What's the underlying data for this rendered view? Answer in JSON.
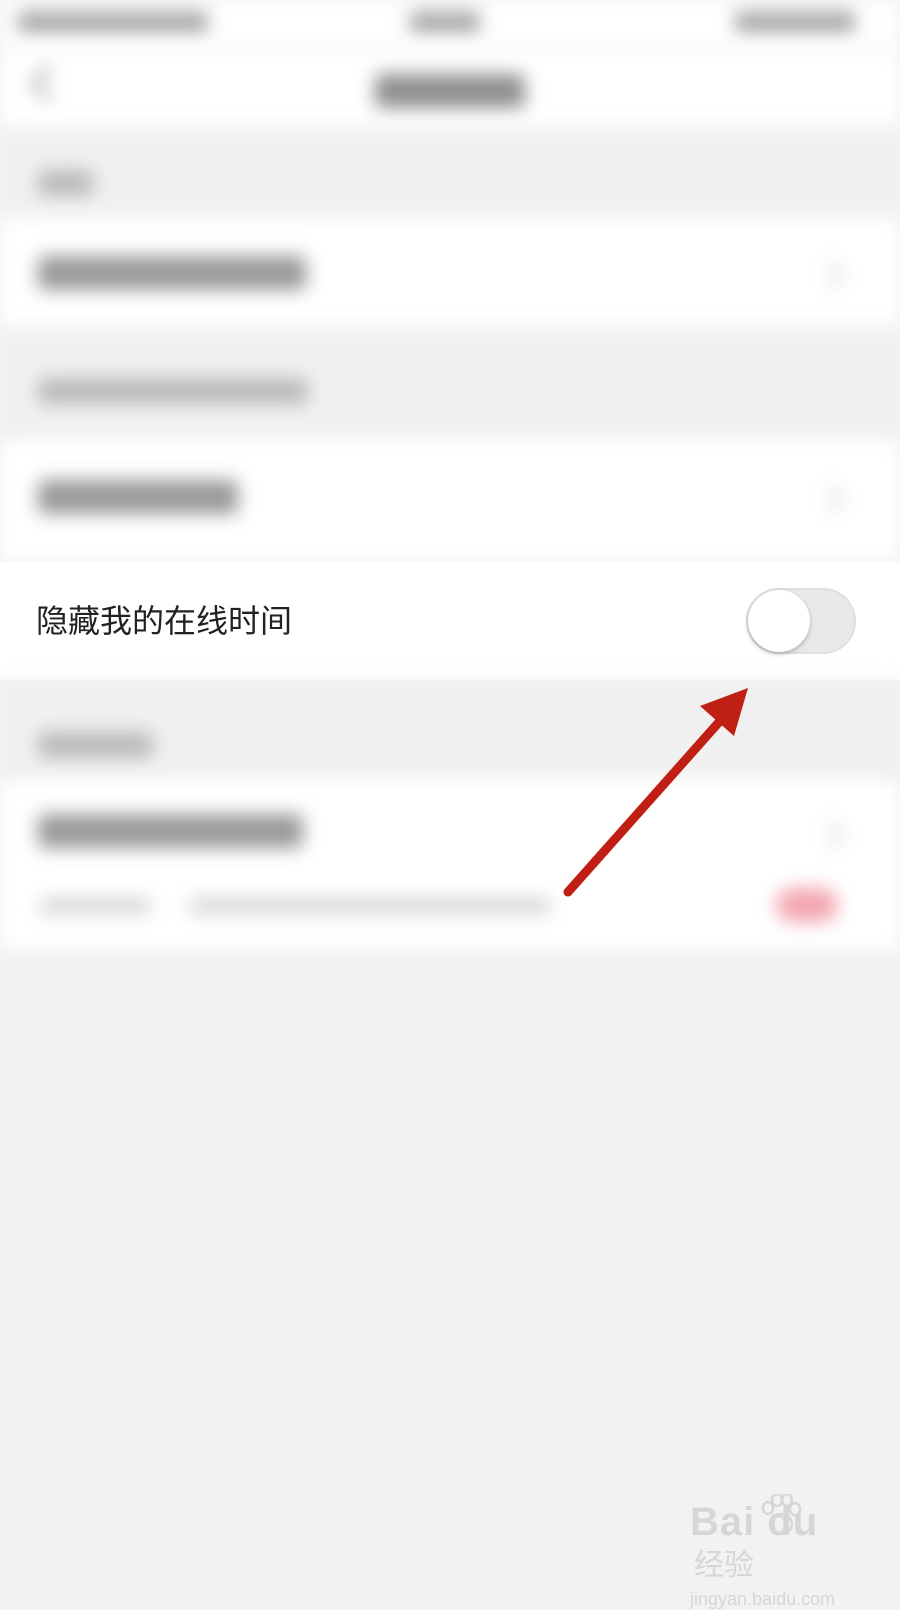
{
  "setting": {
    "label": "隐藏我的在线时间",
    "toggle_on": false
  },
  "watermark": {
    "logo_text": "Bai du",
    "suffix": "经验",
    "url": "jingyan.baidu.com"
  },
  "colors": {
    "page_bg": "#f2f2f2",
    "row_bg": "#ffffff",
    "arrow": "#c01f14",
    "toggle_off_track": "#e9e9e9",
    "badge": "#e53950"
  },
  "icons": [
    "back-icon",
    "chevron-right-icon",
    "toggle-switch",
    "annotation-arrow",
    "baidu-paw-icon"
  ]
}
